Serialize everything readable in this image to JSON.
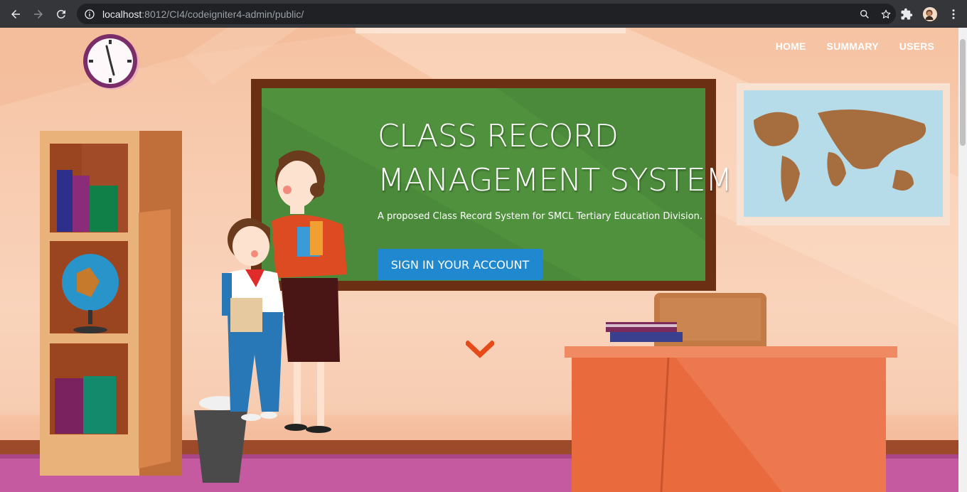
{
  "browser": {
    "url_host": "localhost",
    "url_rest": ":8012/CI4/codeigniter4-admin/public/"
  },
  "nav": {
    "items": [
      "HOME",
      "SUMMARY",
      "USERS"
    ]
  },
  "hero": {
    "title": "CLASS RECORD\nMANAGEMENT SYSTEM",
    "subtitle": "A proposed Class Record System for SMCL Tertiary Education Division.",
    "button_label": "SIGN IN YOUR ACCOUNT"
  },
  "colors": {
    "button": "#1f88cf",
    "chalkboard": "#4a8a3a",
    "scroll_arrow": "#e64a19"
  },
  "icons": {
    "back": "arrow-left",
    "forward": "arrow-right",
    "reload": "reload",
    "info": "info-circle",
    "zoom": "magnifier",
    "bookmark": "star",
    "extensions": "puzzle",
    "menu": "vertical-dots",
    "scroll_down": "chevron-down"
  }
}
